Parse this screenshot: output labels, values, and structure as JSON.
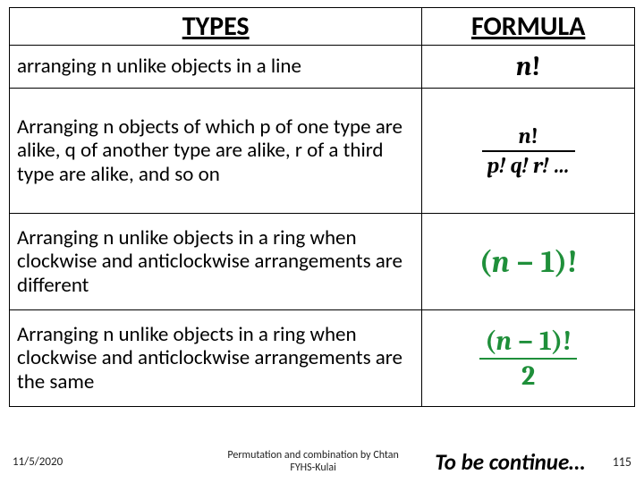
{
  "table": {
    "headers": {
      "types": "TYPES",
      "formula": "FORMULA"
    },
    "rows": [
      {
        "desc": "arranging n unlike objects in a line"
      },
      {
        "desc": "Arranging n objects of which p of one type are alike, q of another type are alike, r of a third type are alike, and so on"
      },
      {
        "desc": "Arranging n unlike objects in a ring when clockwise and anticlockwise arrangements are different"
      },
      {
        "desc": "Arranging n unlike objects in a ring when clockwise and anticlockwise arrangements are the same"
      }
    ]
  },
  "formulas": {
    "r1": {
      "n": "n",
      "bang": "!"
    },
    "r2": {
      "num_n": "n",
      "num_bang": "!",
      "den": "p! q! r! …"
    },
    "r3": {
      "open": "(",
      "n": "n",
      "minus": " − ",
      "one": "1",
      "close": ")",
      "bang": "!"
    },
    "r4": {
      "num_open": "(",
      "num_n": "n",
      "num_minus": " − ",
      "num_one": "1",
      "num_close": ")",
      "num_bang": "!",
      "den": "2"
    }
  },
  "footer": {
    "date": "11/5/2020",
    "center_line1": "Permutation and combination by Chtan",
    "center_line2": "FYHS-Kulai",
    "continue": "To be continue…",
    "pagenum": "115"
  }
}
